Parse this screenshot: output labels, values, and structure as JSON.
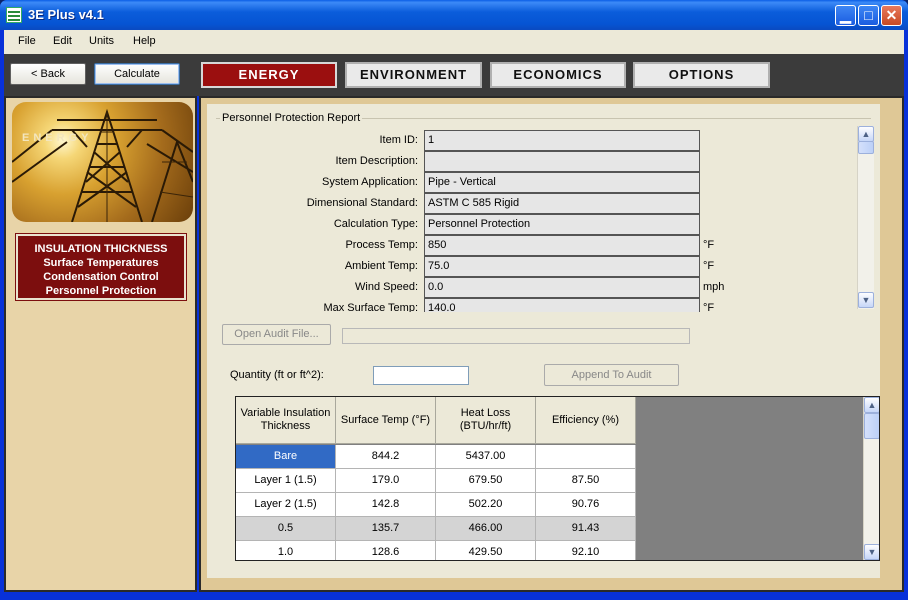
{
  "window": {
    "title": "3E Plus v4.1"
  },
  "menu": [
    "File",
    "Edit",
    "Units",
    "Help"
  ],
  "toolbar": {
    "back_label": "< Back",
    "calculate_label": "Calculate"
  },
  "tabs": [
    "ENERGY",
    "ENVIRONMENT",
    "ECONOMICS",
    "OPTIONS"
  ],
  "active_tab": "ENERGY",
  "sidebar": {
    "image_text": "ENERGY",
    "calc_types": [
      "INSULATION THICKNESS",
      "Surface Temperatures",
      "Condensation Control",
      "Personnel Protection"
    ]
  },
  "report": {
    "title": "Personnel Protection Report",
    "rows": [
      {
        "label": "Item ID:",
        "value": "1",
        "unit": ""
      },
      {
        "label": "Item Description:",
        "value": "",
        "unit": ""
      },
      {
        "label": "System Application:",
        "value": "Pipe - Vertical",
        "unit": ""
      },
      {
        "label": "Dimensional Standard:",
        "value": "ASTM C 585 Rigid",
        "unit": ""
      },
      {
        "label": "Calculation Type:",
        "value": "Personnel Protection",
        "unit": ""
      },
      {
        "label": "Process Temp:",
        "value": "850",
        "unit": "°F"
      },
      {
        "label": "Ambient Temp:",
        "value": "75.0",
        "unit": "°F"
      },
      {
        "label": "Wind Speed:",
        "value": "0.0",
        "unit": "mph"
      },
      {
        "label": "Max Surface Temp:",
        "value": "140.0",
        "unit": "°F"
      }
    ]
  },
  "audit": {
    "open_label": "Open Audit File...",
    "quantity_label": "Quantity (ft or ft^2):",
    "quantity_value": "",
    "append_label": "Append To Audit"
  },
  "results": {
    "headers": [
      "Variable Insulation Thickness",
      "Surface Temp (°F)",
      "Heat Loss (BTU/hr/ft)",
      "Efficiency (%)"
    ],
    "rows": [
      [
        "Bare",
        "844.2",
        "5437.00",
        ""
      ],
      [
        "Layer 1 (1.5)",
        "179.0",
        "679.50",
        "87.50"
      ],
      [
        "Layer 2 (1.5)",
        "142.8",
        "502.20",
        "90.76"
      ],
      [
        "0.5",
        "135.7",
        "466.00",
        "91.43"
      ],
      [
        "1.0",
        "128.6",
        "429.50",
        "92.10"
      ]
    ],
    "selected_row": 0,
    "highlighted_row": 3
  }
}
